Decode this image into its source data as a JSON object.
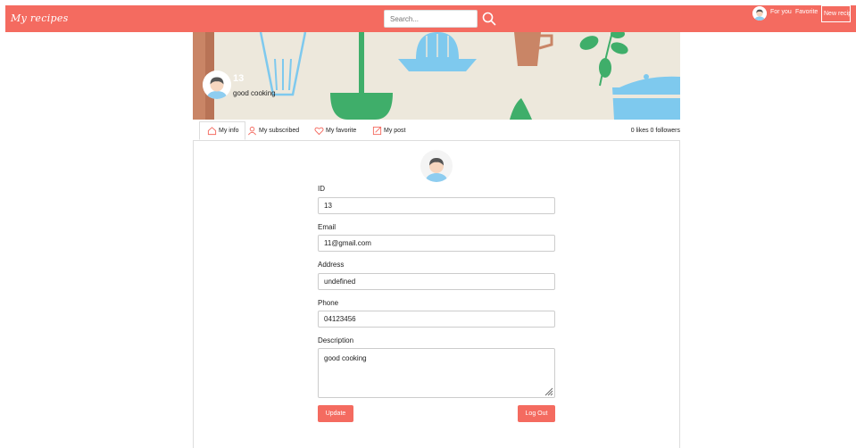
{
  "navbar": {
    "brand": "My recipes",
    "search_placeholder": "Search...",
    "links": [
      "For you",
      "Favorite"
    ],
    "new_button": "New recipe"
  },
  "profile": {
    "id": "13",
    "description": "good cooking"
  },
  "tabs": [
    {
      "label": "My info",
      "icon": "home-icon"
    },
    {
      "label": "My subscribed",
      "icon": "user-icon"
    },
    {
      "label": "My favorite",
      "icon": "heart-icon"
    },
    {
      "label": "My post",
      "icon": "edit-icon"
    }
  ],
  "stats": "0 likes  0 followers",
  "form": {
    "id_label": "ID",
    "id_value": "13",
    "email_label": "Email",
    "email_value": "11@gmail.com",
    "address_label": "Address",
    "address_value": "undefined",
    "phone_label": "Phone",
    "phone_value": "04123456",
    "description_label": "Description",
    "description_value": "good cooking",
    "update_button": "Update",
    "logout_button": "Log Out"
  },
  "colors": {
    "accent": "#f46b60",
    "banner_bg": "#ede8dc"
  }
}
